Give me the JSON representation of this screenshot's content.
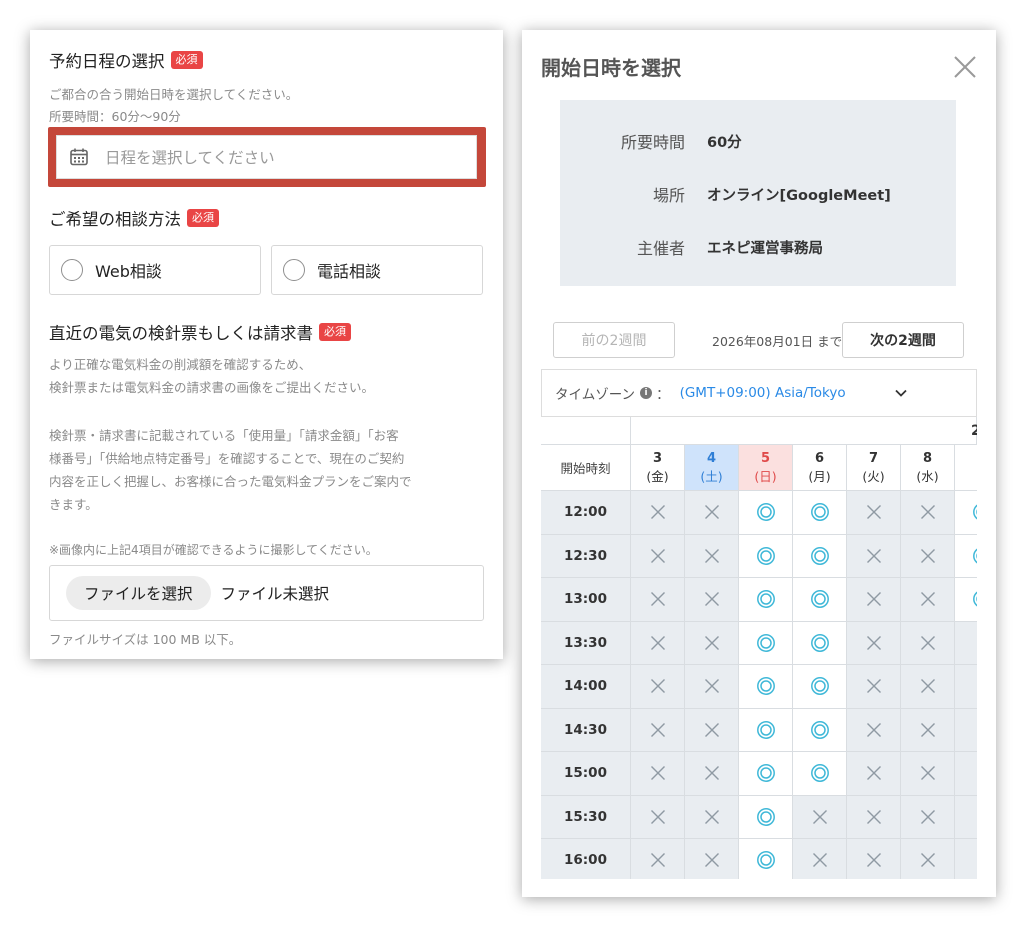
{
  "form": {
    "date_section": {
      "title": "予約日程の選択",
      "required": "必須",
      "help1": "ご都合の合う開始日時を選択してください。",
      "help2": "所要時間：60分〜90分",
      "placeholder": "日程を選択してください"
    },
    "method_section": {
      "title": "ご希望の相談方法",
      "required": "必須",
      "options": [
        "Web相談",
        "電話相談"
      ]
    },
    "bill_section": {
      "title": "直近の電気の検針票もしくは請求書",
      "required": "必須",
      "lines": [
        "より正確な電気料金の削減額を確認するため、",
        "検針票または電気料金の請求書の画像をご提出ください。",
        "",
        "検針票・請求書に記載されている「使用量」「請求金額」「お客",
        "様番号」「供給地点特定番号」を確認することで、現在のご契約",
        "内容を正しく把握し、お客様に合った電気料金プランをご案内で",
        "きます。",
        "",
        "※画像内に上記4項目が確認できるように撮影してください。"
      ],
      "file_button": "ファイルを選択",
      "file_status": "ファイル未選択",
      "size_note": "ファイルサイズは 100 MB 以下。"
    }
  },
  "modal": {
    "title": "開始日時を選択",
    "info": [
      {
        "label": "所要時間",
        "value": "60分"
      },
      {
        "label": "場所",
        "value": "オンライン[GoogleMeet]"
      },
      {
        "label": "主催者",
        "value": "エネピ運営事務局"
      }
    ],
    "prev_label": "前の2週間",
    "until_text": "2026年08月01日 まで",
    "next_label": "次の2週間",
    "timezone_label": "タイムゾーン",
    "timezone_colon": "：",
    "timezone_value": "(GMT+09:00) Asia/Tokyo",
    "start_time_label": "開始時刻",
    "header_partial": "2",
    "days": [
      {
        "num": "3",
        "dow": "(金)",
        "kind": "weekday"
      },
      {
        "num": "4",
        "dow": "(土)",
        "kind": "sat"
      },
      {
        "num": "5",
        "dow": "(日)",
        "kind": "sun"
      },
      {
        "num": "6",
        "dow": "(月)",
        "kind": "weekday"
      },
      {
        "num": "7",
        "dow": "(火)",
        "kind": "weekday"
      },
      {
        "num": "8",
        "dow": "(水)",
        "kind": "weekday"
      },
      {
        "num": "",
        "dow": "(",
        "kind": "weekday"
      }
    ],
    "times": [
      "12:00",
      "12:30",
      "13:00",
      "13:30",
      "14:00",
      "14:30",
      "15:00",
      "15:30",
      "16:00"
    ],
    "availability": [
      [
        "x",
        "x",
        "o",
        "o",
        "x",
        "x",
        "o"
      ],
      [
        "x",
        "x",
        "o",
        "o",
        "x",
        "x",
        "o"
      ],
      [
        "x",
        "x",
        "o",
        "o",
        "x",
        "x",
        "o"
      ],
      [
        "x",
        "x",
        "o",
        "o",
        "x",
        "x",
        "-"
      ],
      [
        "x",
        "x",
        "o",
        "o",
        "x",
        "x",
        "-"
      ],
      [
        "x",
        "x",
        "o",
        "o",
        "x",
        "x",
        "-"
      ],
      [
        "x",
        "x",
        "o",
        "o",
        "x",
        "x",
        "-"
      ],
      [
        "x",
        "x",
        "o",
        "x",
        "x",
        "x",
        "-"
      ],
      [
        "x",
        "x",
        "o",
        "x",
        "x",
        "x",
        "-"
      ]
    ],
    "colors": {
      "available": "#3fb8d8",
      "unavailable": "#8f9aa3",
      "highlight": "#c4473a"
    }
  }
}
